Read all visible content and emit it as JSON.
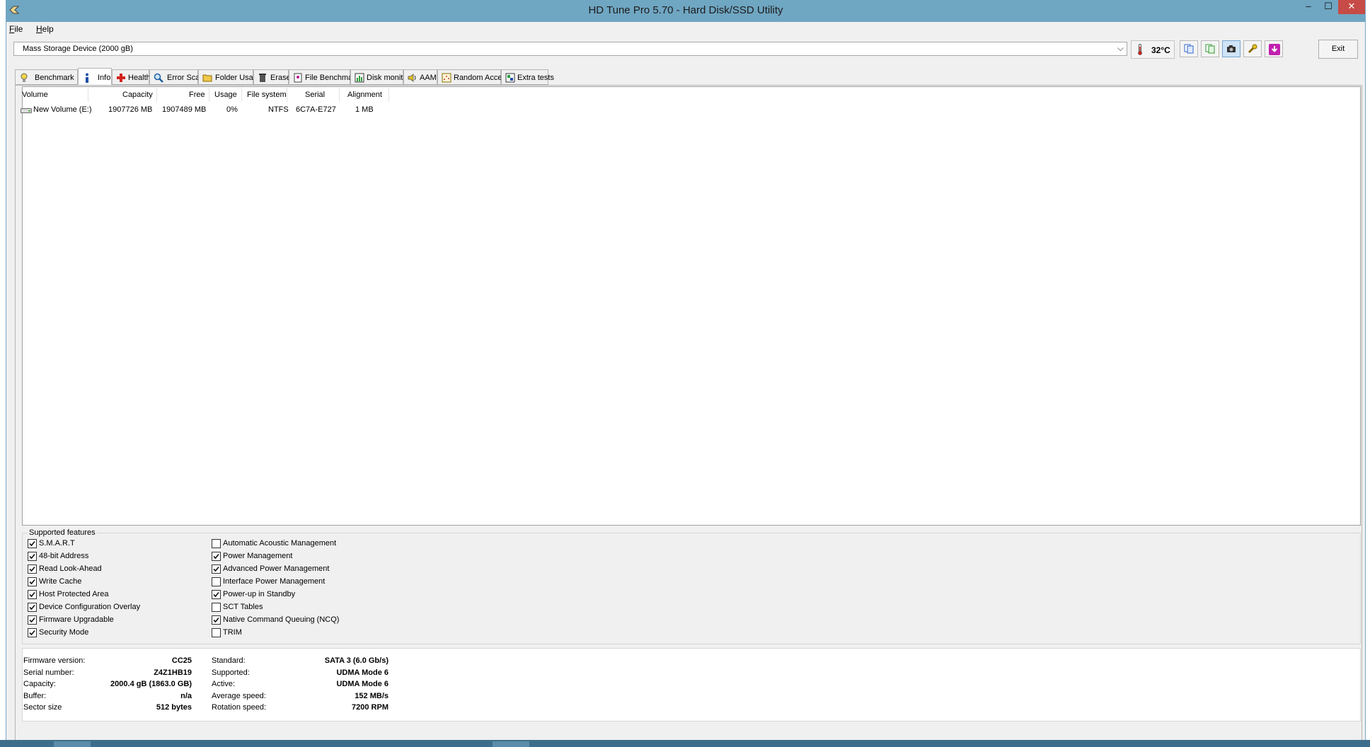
{
  "window": {
    "title": "HD Tune Pro 5.70 - Hard Disk/SSD Utility",
    "min": "–",
    "max": "☐",
    "close": "✕"
  },
  "menu": {
    "file_underline": "F",
    "file_rest": "ile",
    "help_underline": "H",
    "help_rest": "elp"
  },
  "toolbar": {
    "device": "Mass Storage Device (2000 gB)",
    "temperature": "32°C",
    "exit_label": "Exit"
  },
  "tabs": [
    {
      "label": "Benchmark",
      "icon": "lightbulb-icon"
    },
    {
      "label": "Info",
      "icon": "info-icon"
    },
    {
      "label": "Health",
      "icon": "health-cross-icon"
    },
    {
      "label": "Error Scan",
      "icon": "magnifier-icon"
    },
    {
      "label": "Folder Usage",
      "icon": "folder-icon"
    },
    {
      "label": "Erase",
      "icon": "trash-icon"
    },
    {
      "label": "File Benchmark",
      "icon": "file-benchmark-icon"
    },
    {
      "label": "Disk monitor",
      "icon": "disk-monitor-icon"
    },
    {
      "label": "AAM",
      "icon": "speaker-icon"
    },
    {
      "label": "Random Access",
      "icon": "random-access-icon"
    },
    {
      "label": "Extra tests",
      "icon": "extra-tests-icon"
    }
  ],
  "volumes": {
    "columns": [
      "Volume",
      "Capacity",
      "Free",
      "Usage",
      "File system",
      "Serial",
      "Alignment"
    ],
    "rows": [
      {
        "volume": "New Volume (E:)",
        "capacity": "1907726 MB",
        "free": "1907489 MB",
        "usage": "0%",
        "filesystem": "NTFS",
        "serial": "6C7A-E727",
        "alignment": "1 MB"
      }
    ]
  },
  "features": {
    "title": "Supported features",
    "left": [
      {
        "label": "S.M.A.R.T",
        "checked": true
      },
      {
        "label": "48-bit Address",
        "checked": true
      },
      {
        "label": "Read Look-Ahead",
        "checked": true
      },
      {
        "label": "Write Cache",
        "checked": true
      },
      {
        "label": "Host Protected Area",
        "checked": true
      },
      {
        "label": "Device Configuration Overlay",
        "checked": true
      },
      {
        "label": "Firmware Upgradable",
        "checked": true
      },
      {
        "label": "Security Mode",
        "checked": true
      }
    ],
    "right": [
      {
        "label": "Automatic Acoustic Management",
        "checked": false
      },
      {
        "label": "Power Management",
        "checked": true
      },
      {
        "label": "Advanced Power Management",
        "checked": true
      },
      {
        "label": "Interface Power Management",
        "checked": false
      },
      {
        "label": "Power-up in Standby",
        "checked": true
      },
      {
        "label": "SCT Tables",
        "checked": false
      },
      {
        "label": "Native Command Queuing (NCQ)",
        "checked": true
      },
      {
        "label": "TRIM",
        "checked": false
      }
    ]
  },
  "info": {
    "left": [
      {
        "label": "Firmware version:",
        "value": "CC25"
      },
      {
        "label": "Serial number:",
        "value": "Z4Z1HB19"
      },
      {
        "label": "Capacity:",
        "value": "2000.4 gB (1863.0 GB)"
      },
      {
        "label": "Buffer:",
        "value": "n/a"
      },
      {
        "label": "Sector size",
        "value": "512 bytes"
      }
    ],
    "right": [
      {
        "label": "Standard:",
        "value": "SATA 3 (6.0 Gb/s)"
      },
      {
        "label": "Supported:",
        "value": "UDMA Mode 6"
      },
      {
        "label": "Active:",
        "value": "UDMA Mode 6"
      },
      {
        "label": "Average speed:",
        "value": "152 MB/s"
      },
      {
        "label": "Rotation speed:",
        "value": "7200 RPM"
      }
    ]
  }
}
